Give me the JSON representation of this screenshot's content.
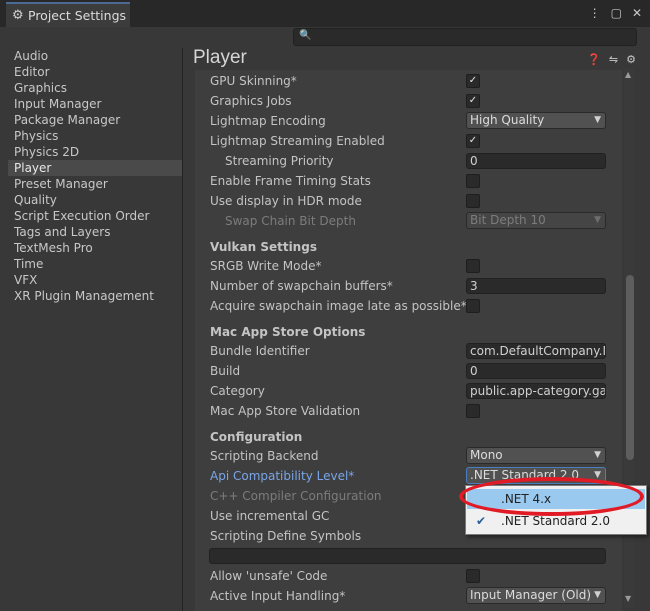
{
  "window": {
    "title": "Project Settings",
    "title_icons": [
      "⋮",
      "▢",
      "✕"
    ]
  },
  "search": {
    "placeholder": "",
    "icon": "search-icon"
  },
  "sidebar": {
    "items": [
      {
        "label": "Audio"
      },
      {
        "label": "Editor"
      },
      {
        "label": "Graphics"
      },
      {
        "label": "Input Manager"
      },
      {
        "label": "Package Manager"
      },
      {
        "label": "Physics"
      },
      {
        "label": "Physics 2D"
      },
      {
        "label": "Player",
        "active": true
      },
      {
        "label": "Preset Manager"
      },
      {
        "label": "Quality"
      },
      {
        "label": "Script Execution Order"
      },
      {
        "label": "Tags and Layers"
      },
      {
        "label": "TextMesh Pro"
      },
      {
        "label": "Time"
      },
      {
        "label": "VFX"
      },
      {
        "label": "XR Plugin Management"
      }
    ]
  },
  "main": {
    "title": "Player",
    "header_icons": [
      "help-icon",
      "presets-icon",
      "gear-icon"
    ]
  },
  "settings": {
    "gpu_skinning": {
      "label": "GPU Skinning*",
      "checked": true
    },
    "graphics_jobs": {
      "label": "Graphics Jobs",
      "checked": true
    },
    "lightmap_encoding": {
      "label": "Lightmap Encoding",
      "value": "High Quality"
    },
    "lightmap_streaming": {
      "label": "Lightmap Streaming Enabled",
      "checked": true
    },
    "streaming_priority": {
      "label": "Streaming Priority",
      "value": "0"
    },
    "frame_timing": {
      "label": "Enable Frame Timing Stats",
      "checked": false
    },
    "hdr_display": {
      "label": "Use display in HDR mode",
      "checked": false
    },
    "swap_chain": {
      "label": "Swap Chain Bit Depth",
      "value": "Bit Depth 10"
    },
    "vulkan_header": "Vulkan Settings",
    "srgb_write": {
      "label": "SRGB Write Mode*",
      "checked": false
    },
    "swapchain_buffers": {
      "label": "Number of swapchain buffers*",
      "value": "3"
    },
    "acquire_late": {
      "label": "Acquire swapchain image late as possible*",
      "checked": false
    },
    "mac_header": "Mac App Store Options",
    "bundle_id": {
      "label": "Bundle Identifier",
      "value": "com.DefaultCompany.M"
    },
    "build": {
      "label": "Build",
      "value": "0"
    },
    "category": {
      "label": "Category",
      "value": "public.app-category.gan"
    },
    "mac_validation": {
      "label": "Mac App Store Validation",
      "checked": false
    },
    "config_header": "Configuration",
    "scripting_backend": {
      "label": "Scripting Backend",
      "value": "Mono"
    },
    "api_level": {
      "label": "Api Compatibility Level*",
      "value": ".NET Standard 2.0"
    },
    "cpp_config": {
      "label": "C++ Compiler Configuration"
    },
    "incremental_gc": {
      "label": "Use incremental GC"
    },
    "define_symbols": {
      "label": "Scripting Define Symbols"
    },
    "unsafe_code": {
      "label": "Allow 'unsafe' Code",
      "checked": false
    },
    "input_handling": {
      "label": "Active Input Handling*",
      "value": "Input Manager (Old)"
    }
  },
  "popup": {
    "options": [
      {
        "label": ".NET 4.x",
        "highlighted": true,
        "selected": false
      },
      {
        "label": ".NET Standard 2.0",
        "highlighted": false,
        "selected": true
      }
    ]
  },
  "colors": {
    "annotation": "#e11b26",
    "highlight": "#99c9ef",
    "link": "#79a5e8"
  }
}
